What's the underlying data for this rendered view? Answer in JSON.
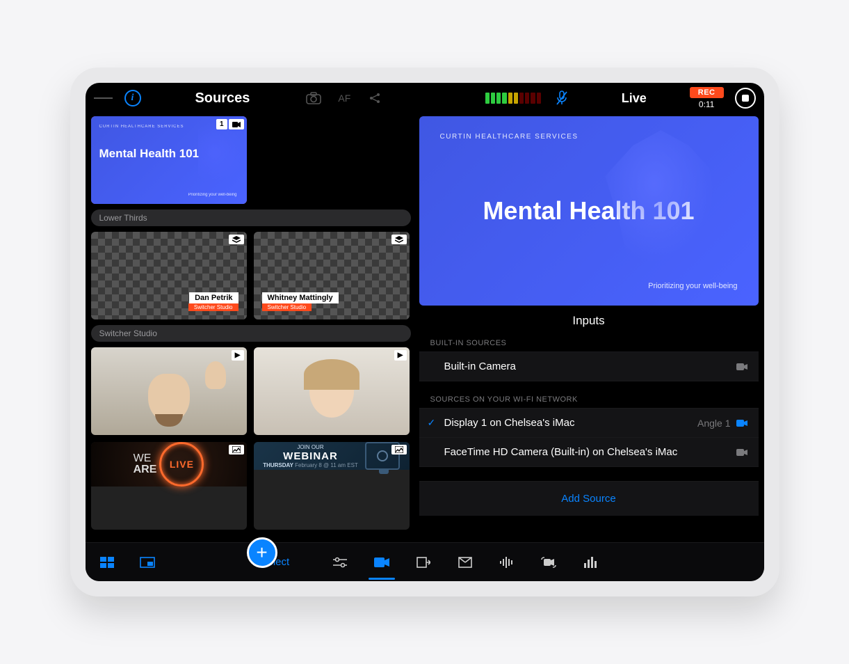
{
  "topbar": {
    "sources_title": "Sources",
    "af_label": "AF",
    "live_label": "Live",
    "rec_label": "REC",
    "rec_time": "0:11"
  },
  "slide": {
    "brand": "CURTIN HEALTHCARE SERVICES",
    "title": "Mental Health 101",
    "subtitle": "Prioritizing your well-being"
  },
  "source_card_badge_number": "1",
  "sections": {
    "lower_thirds": "Lower Thirds",
    "switcher_studio": "Switcher Studio"
  },
  "lower_thirds": [
    {
      "name": "Dan Petrik",
      "sub": "Switcher Studio"
    },
    {
      "name": "Whitney Mattingly",
      "sub": "Switcher Studio"
    }
  ],
  "promo": {
    "we": "WE",
    "are": "ARE",
    "live": "LIVE",
    "join": "JOIN OUR",
    "webinar": "WEBINAR",
    "day": "THURSDAY",
    "time": "February 8 @ 11 am EST"
  },
  "inputs": {
    "title": "Inputs",
    "builtin_section": "BUILT-IN SOURCES",
    "builtin_camera": "Built-in Camera",
    "wifi_section": "SOURCES ON YOUR WI-FI NETWORK",
    "items": [
      {
        "name": "Display 1 on Chelsea's iMac",
        "angle": "Angle 1",
        "checked": true,
        "active": true
      },
      {
        "name": "FaceTime HD Camera (Built-in) on Chelsea's iMac",
        "angle": "",
        "checked": false,
        "active": false
      }
    ],
    "add_source": "Add Source"
  },
  "bottombar": {
    "select": "Select"
  }
}
